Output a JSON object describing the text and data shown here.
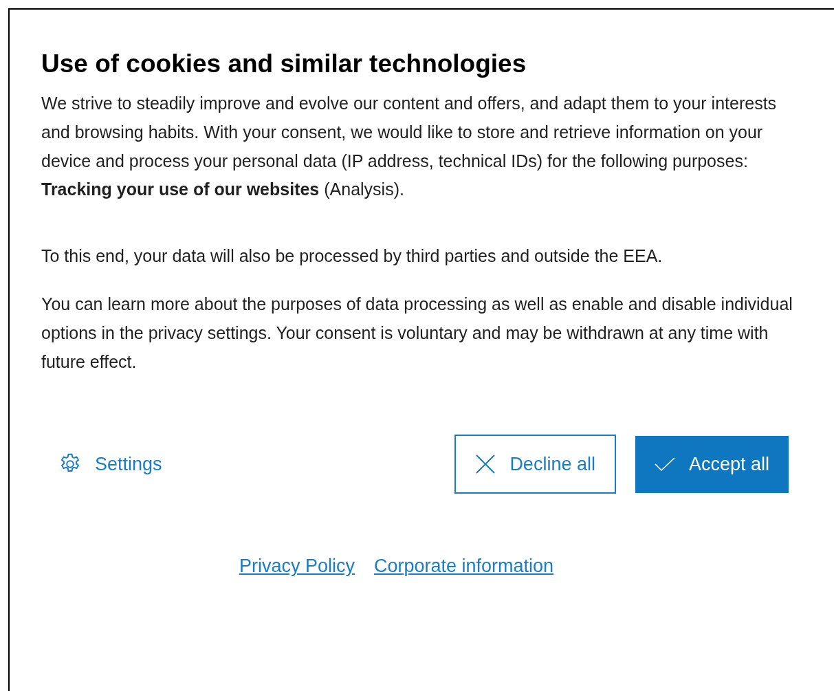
{
  "dialog": {
    "title": "Use of cookies and similar technologies",
    "paragraphs": [
      "We strive to steadily improve and evolve our content and offers, and adapt them to your interests and browsing habits. With your consent, we would like to store and retrieve information on your device and process your personal data (IP address, technical IDs) for the following purposes: **Tracking your use of our websites** (Analysis).",
      "To this end, your data will also be processed by third parties and outside the EEA.",
      "You can learn more about the purposes of data processing as well as enable and disable individual options in the privacy settings. Your consent is voluntary and may be withdrawn at any time with future effect."
    ],
    "actions": [
      {
        "kind": "link",
        "label": "Settings"
      },
      {
        "kind": "secondary",
        "label": "Decline all"
      },
      {
        "kind": "primary",
        "label": "Accept all"
      }
    ],
    "footer_links": [
      "Privacy Policy",
      "Corporate information"
    ]
  }
}
